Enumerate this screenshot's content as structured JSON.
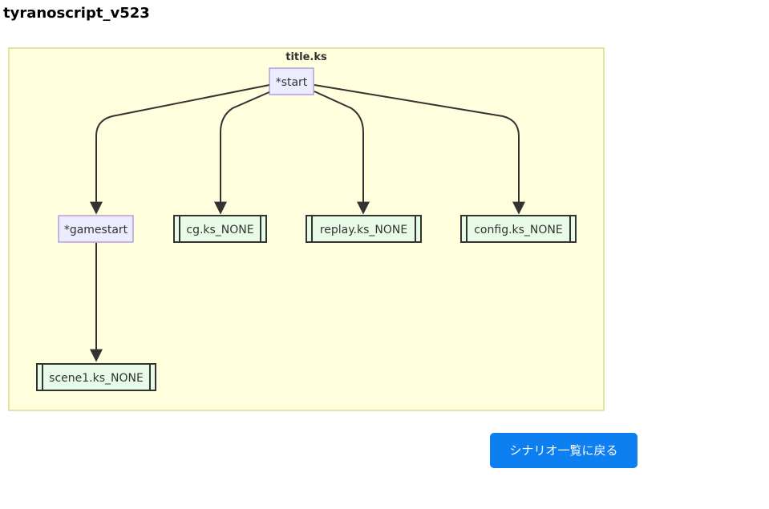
{
  "page": {
    "title": "tyranoscript_v523"
  },
  "diagram": {
    "cluster_label": "title.ks",
    "nodes": {
      "start": "*start",
      "gamestart": "*gamestart",
      "cg": "cg.ks_NONE",
      "replay": "replay.ks_NONE",
      "config": "config.ks_NONE",
      "scene1": "scene1.ks_NONE"
    },
    "colors": {
      "cluster_fill": "#ffffde",
      "cluster_stroke": "#d1cf7a",
      "label_node_fill": "#ececff",
      "label_node_stroke": "#9370db",
      "file_node_fill": "#e8fbe6",
      "file_node_stroke": "#333333",
      "edge": "#333333"
    },
    "edges": [
      [
        "start",
        "gamestart"
      ],
      [
        "start",
        "cg"
      ],
      [
        "start",
        "replay"
      ],
      [
        "start",
        "config"
      ],
      [
        "gamestart",
        "scene1"
      ]
    ]
  },
  "footer": {
    "back_button_label": "シナリオ一覧に戻る",
    "back_button_color": "#0d7ff0"
  }
}
